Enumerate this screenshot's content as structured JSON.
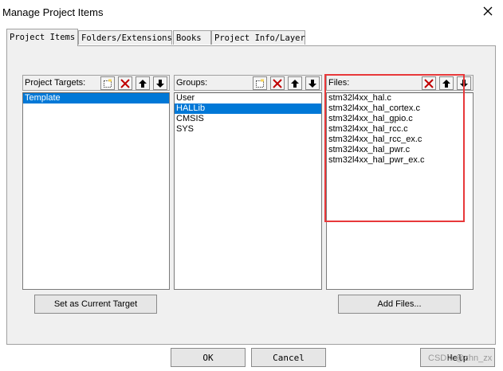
{
  "window": {
    "title": "Manage Project Items"
  },
  "tabs": [
    {
      "label": "Project Items"
    },
    {
      "label": "Folders/Extensions"
    },
    {
      "label": "Books"
    },
    {
      "label": "Project Info/Layer"
    }
  ],
  "targets": {
    "label": "Project Targets:",
    "items": [
      "Template"
    ],
    "selected": 0
  },
  "groups": {
    "label": "Groups:",
    "items": [
      "User",
      "HALLib",
      "CMSIS",
      "SYS"
    ],
    "selected": 1
  },
  "files": {
    "label": "Files:",
    "items": [
      "stm32l4xx_hal.c",
      "stm32l4xx_hal_cortex.c",
      "stm32l4xx_hal_gpio.c",
      "stm32l4xx_hal_rcc.c",
      "stm32l4xx_hal_rcc_ex.c",
      "stm32l4xx_hal_pwr.c",
      "stm32l4xx_hal_pwr_ex.c"
    ]
  },
  "buttons": {
    "set_current": "Set as Current Target",
    "add_files": "Add Files...",
    "ok": "OK",
    "cancel": "Cancel",
    "help": "Help"
  },
  "watermark": "CSDN @zhn_zx",
  "colors": {
    "selection": "#0078d7",
    "highlight_box": "#e8383a",
    "delete_icon": "#c00000"
  }
}
